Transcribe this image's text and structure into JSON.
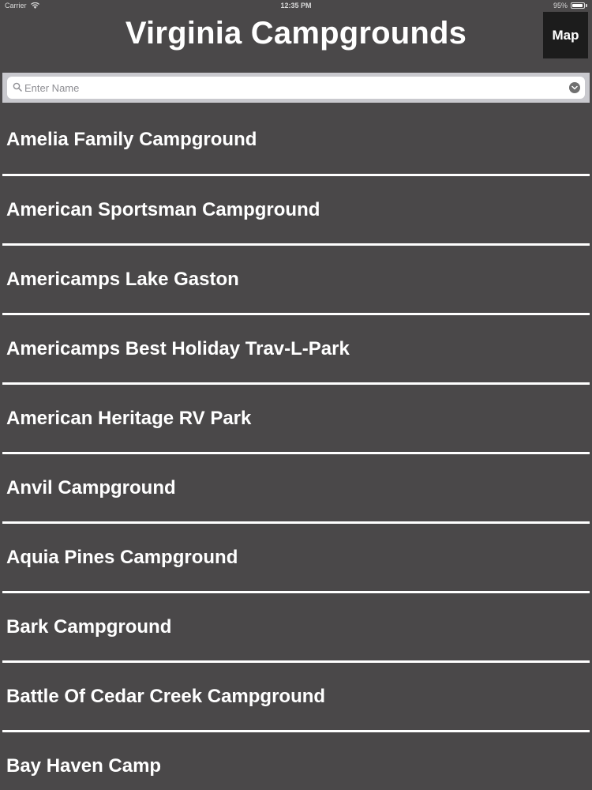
{
  "status_bar": {
    "carrier": "Carrier",
    "time": "12:35 PM",
    "battery": "95%",
    "battery_level": 0.95
  },
  "header": {
    "title": "Virginia Campgrounds",
    "map_label": "Map"
  },
  "search": {
    "placeholder": "Enter Name",
    "value": ""
  },
  "campgrounds": [
    "Amelia Family Campground",
    "American Sportsman Campground",
    "Americamps Lake Gaston",
    "Americamps Best Holiday Trav-L-Park",
    "American Heritage RV Park",
    "Anvil Campground",
    "Aquia Pines Campground",
    "Bark Campground",
    "Battle Of Cedar Creek Campground",
    "Bay Haven Camp"
  ],
  "colors": {
    "background": "#4a4849",
    "separator": "#ffffff",
    "map_button": "#1c1c1c",
    "search_bar": "#c9c9ce"
  },
  "icons": {
    "wifi": "wifi-icon",
    "battery": "battery-icon",
    "search": "search-icon",
    "dropdown": "chevron-down-icon"
  }
}
